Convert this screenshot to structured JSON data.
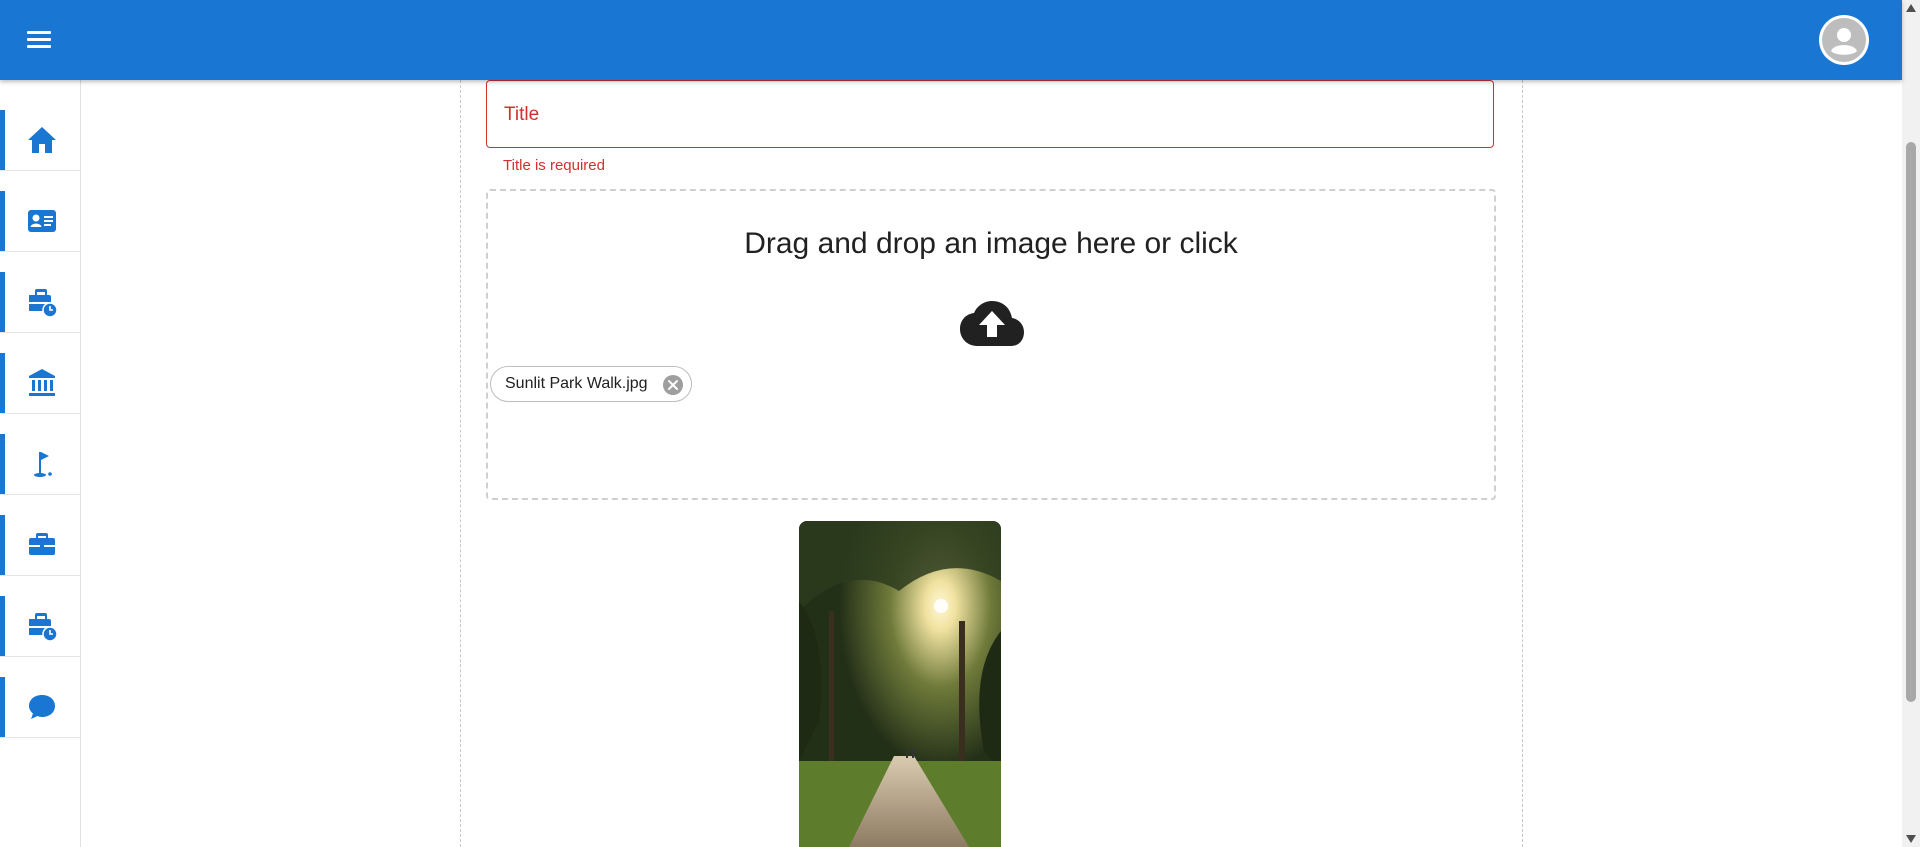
{
  "theme": {
    "primary": "#1976d2",
    "error": "#d32f2f",
    "text": "#212121"
  },
  "appbar": {
    "menu_icon": "menu-icon",
    "avatar_icon": "account-circle-icon"
  },
  "sidebar": {
    "items": [
      {
        "id": "home",
        "icon": "home-icon"
      },
      {
        "id": "contact-card",
        "icon": "contact-card-icon"
      },
      {
        "id": "work-history",
        "icon": "briefcase-clock-icon"
      },
      {
        "id": "institution",
        "icon": "bank-icon"
      },
      {
        "id": "golf",
        "icon": "golf-flag-icon"
      },
      {
        "id": "work",
        "icon": "briefcase-icon"
      },
      {
        "id": "work-schedule",
        "icon": "briefcase-clock-icon"
      },
      {
        "id": "chat",
        "icon": "chat-bubble-icon"
      }
    ]
  },
  "form": {
    "title_placeholder": "Title",
    "title_error": "Title is required",
    "dropzone_text": "Drag and drop an image here or click",
    "dropzone_icon": "cloud-upload-icon",
    "file_chip": {
      "label": "Sunlit Park Walk.jpg",
      "delete_icon": "cancel-circle-icon"
    },
    "preview": {
      "subject": "sunlit tree-lined park path"
    }
  }
}
